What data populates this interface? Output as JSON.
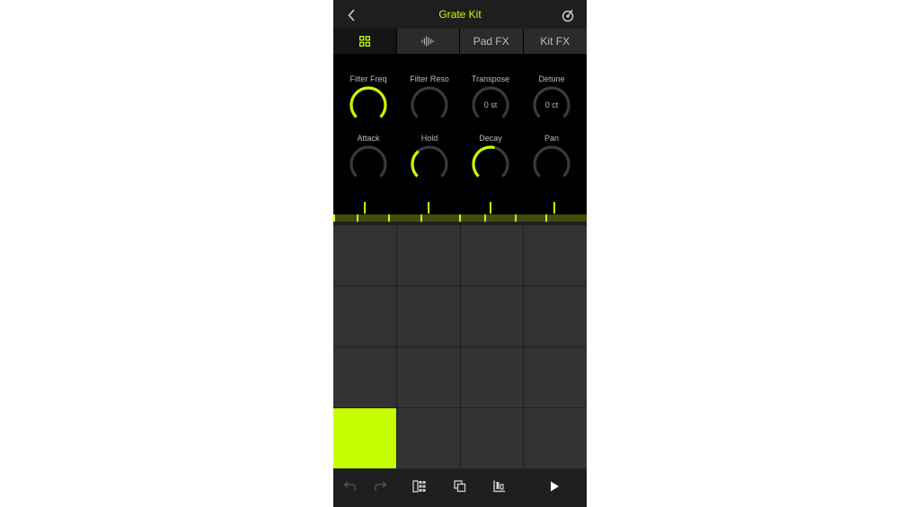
{
  "header": {
    "title": "Grate Kit",
    "back_icon": "chevron-left-icon",
    "tuner_icon": "tuner-icon"
  },
  "tabs": [
    {
      "label": "",
      "icon": "grid-icon",
      "active": true
    },
    {
      "label": "",
      "icon": "waveform-icon",
      "active": false
    },
    {
      "label": "Pad FX",
      "active": false
    },
    {
      "label": "Kit FX",
      "active": false
    }
  ],
  "knobs": [
    {
      "label": "Filter Freq",
      "value": "",
      "level": 1.0
    },
    {
      "label": "Filter Reso",
      "value": "",
      "level": 0.0
    },
    {
      "label": "Transpose",
      "value": "0 st",
      "level": 0.0
    },
    {
      "label": "Detune",
      "value": "0 ct",
      "level": 0.0
    },
    {
      "label": "Attack",
      "value": "",
      "level": 0.0
    },
    {
      "label": "Hold",
      "value": "",
      "level": 0.35
    },
    {
      "label": "Decay",
      "value": "",
      "level": 0.55
    },
    {
      "label": "Pan",
      "value": "",
      "level": 0.0
    }
  ],
  "colors": {
    "accent": "#c6ff00",
    "pad": "#333333",
    "knob_track": "#3a3a3a",
    "background": "#000000",
    "toolbar": "#1f1f1f"
  },
  "pads": {
    "count": 16,
    "active_index": 12
  },
  "toolbar": {
    "undo_icon": "undo-icon",
    "redo_icon": "redo-icon",
    "sequencer_icon": "sequencer-grid-icon",
    "duplicate_icon": "duplicate-icon",
    "align_icon": "align-icon",
    "play_icon": "play-icon"
  }
}
